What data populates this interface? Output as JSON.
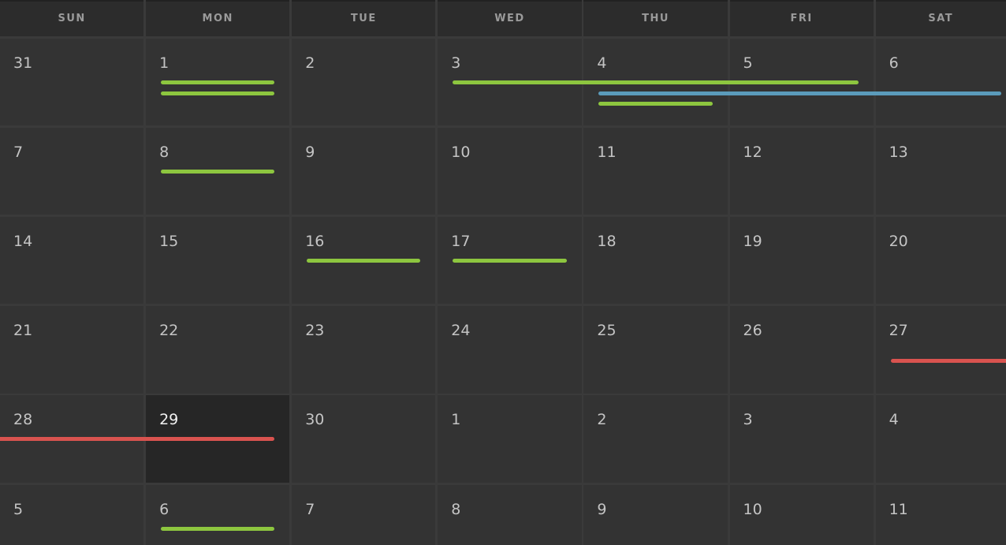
{
  "weekdays": [
    "SUN",
    "MON",
    "TUE",
    "WED",
    "THU",
    "FRI",
    "SAT"
  ],
  "weeks": [
    [
      "31",
      "1",
      "2",
      "3",
      "4",
      "5",
      "6"
    ],
    [
      "7",
      "8",
      "9",
      "10",
      "11",
      "12",
      "13"
    ],
    [
      "14",
      "15",
      "16",
      "17",
      "18",
      "19",
      "20"
    ],
    [
      "21",
      "22",
      "23",
      "24",
      "25",
      "26",
      "27"
    ],
    [
      "28",
      "29",
      "30",
      "1",
      "2",
      "3",
      "4"
    ],
    [
      "5",
      "6",
      "7",
      "8",
      "9",
      "10",
      "11"
    ]
  ],
  "today": {
    "week": 4,
    "day": 1
  },
  "colors": {
    "green": "#8dc63f",
    "blue": "#5b9bbb",
    "red": "#d9534f"
  },
  "events": [
    {
      "week": 0,
      "start": 1,
      "end": 1,
      "lane": 0,
      "color": "green"
    },
    {
      "week": 0,
      "start": 1,
      "end": 1,
      "lane": 1,
      "color": "green"
    },
    {
      "week": 0,
      "start": 3,
      "end": 5,
      "lane": 0,
      "color": "green"
    },
    {
      "week": 0,
      "start": 4,
      "end": 6,
      "lane": 1,
      "color": "blue",
      "continues_right": true
    },
    {
      "week": 0,
      "start": 4,
      "end": 4,
      "lane": 2,
      "color": "green"
    },
    {
      "week": 1,
      "start": 1,
      "end": 1,
      "lane": 0,
      "color": "green"
    },
    {
      "week": 2,
      "start": 2,
      "end": 2,
      "lane": 0,
      "color": "green"
    },
    {
      "week": 2,
      "start": 3,
      "end": 3,
      "lane": 0,
      "color": "green"
    },
    {
      "week": 3,
      "start": 6,
      "end": 6,
      "lane": 1,
      "color": "red",
      "continues_right": true
    },
    {
      "week": 4,
      "start": 0,
      "end": 1,
      "lane": 0,
      "color": "red",
      "continues_left": true
    },
    {
      "week": 5,
      "start": 1,
      "end": 1,
      "lane": 0,
      "color": "green"
    }
  ]
}
